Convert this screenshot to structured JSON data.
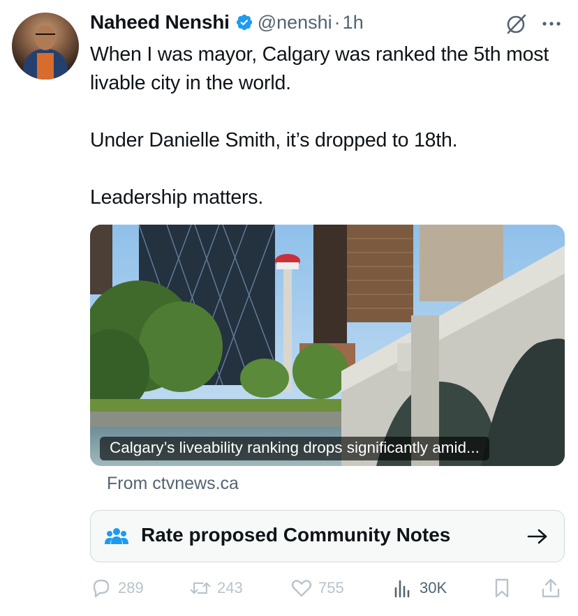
{
  "author": {
    "name": "Naheed Nenshi",
    "handle": "@nenshi",
    "separator": "·",
    "time": "1h"
  },
  "tweet": {
    "paragraphs": [
      "When I was mayor, Calgary was ranked the 5th most livable city in the world.",
      "Under Danielle Smith, it’s dropped to 18th.",
      "Leadership matters."
    ]
  },
  "card": {
    "caption": "Calgary’s liveability ranking drops significantly amid...",
    "source": "From ctvnews.ca"
  },
  "community_notes": {
    "label": "Rate proposed Community Notes"
  },
  "actions": {
    "replies": "289",
    "retweets": "243",
    "likes": "755",
    "views": "30K"
  },
  "icons": {
    "verified": "verified-badge-icon",
    "grok": "grok-icon",
    "more": "more-icon",
    "notes": "people-icon",
    "arrow": "arrow-right-icon",
    "reply": "reply-icon",
    "retweet": "retweet-icon",
    "like": "heart-icon",
    "views": "views-icon",
    "bookmark": "bookmark-icon",
    "share": "share-icon"
  },
  "colors": {
    "verified": "#1d9bf0",
    "text": "#0f1419",
    "secondary": "#536471",
    "muted_action": "#b8c3cc",
    "notes_background": "#f7f9f9",
    "border": "#cfd9de"
  }
}
